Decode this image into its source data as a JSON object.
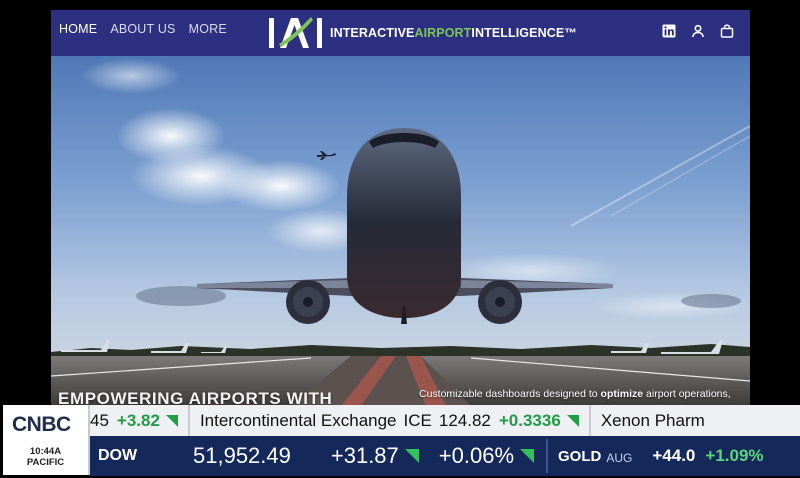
{
  "nav": {
    "links": [
      "HOME",
      "ABOUT US",
      "MORE"
    ],
    "logo_mark": "IAI",
    "logo_text_1": "INTERACTIVE",
    "logo_text_2": "AIRPORT",
    "logo_text_3": "INTELLIGENCE™",
    "icons": [
      "linkedin-icon",
      "user-icon",
      "cart-icon"
    ]
  },
  "hero": {
    "heading": "EMPOWERING AIRPORTS WITH",
    "sub_before": "Customizable dashboards designed to ",
    "sub_bold": "optimize",
    "sub_after": " airport operations,"
  },
  "cnbc": {
    "logo": "CNBC",
    "time": "10:44",
    "ampm": "A",
    "zone": "PACIFIC"
  },
  "ticker_top": {
    "prev_value_tail": "45",
    "prev_change": "+3.82",
    "stock_name": "Intercontinental Exchange",
    "stock_symbol": "ICE",
    "stock_price": "124.82",
    "stock_change": "+0.3336",
    "next_name": "Xenon Pharm"
  },
  "ticker_bottom": {
    "index": "DOW",
    "value": "51,952.49",
    "change": "+31.87",
    "pct": "+0.06%",
    "commodity": "GOLD",
    "month": "AUG",
    "commodity_change": "+44.0",
    "commodity_pct": "+1.09%"
  },
  "colors": {
    "nav_bg": "#2d2f80",
    "logo_accent": "#7fc458",
    "ticker_green": "#1f9e45",
    "ticker_navy": "#14285a"
  }
}
